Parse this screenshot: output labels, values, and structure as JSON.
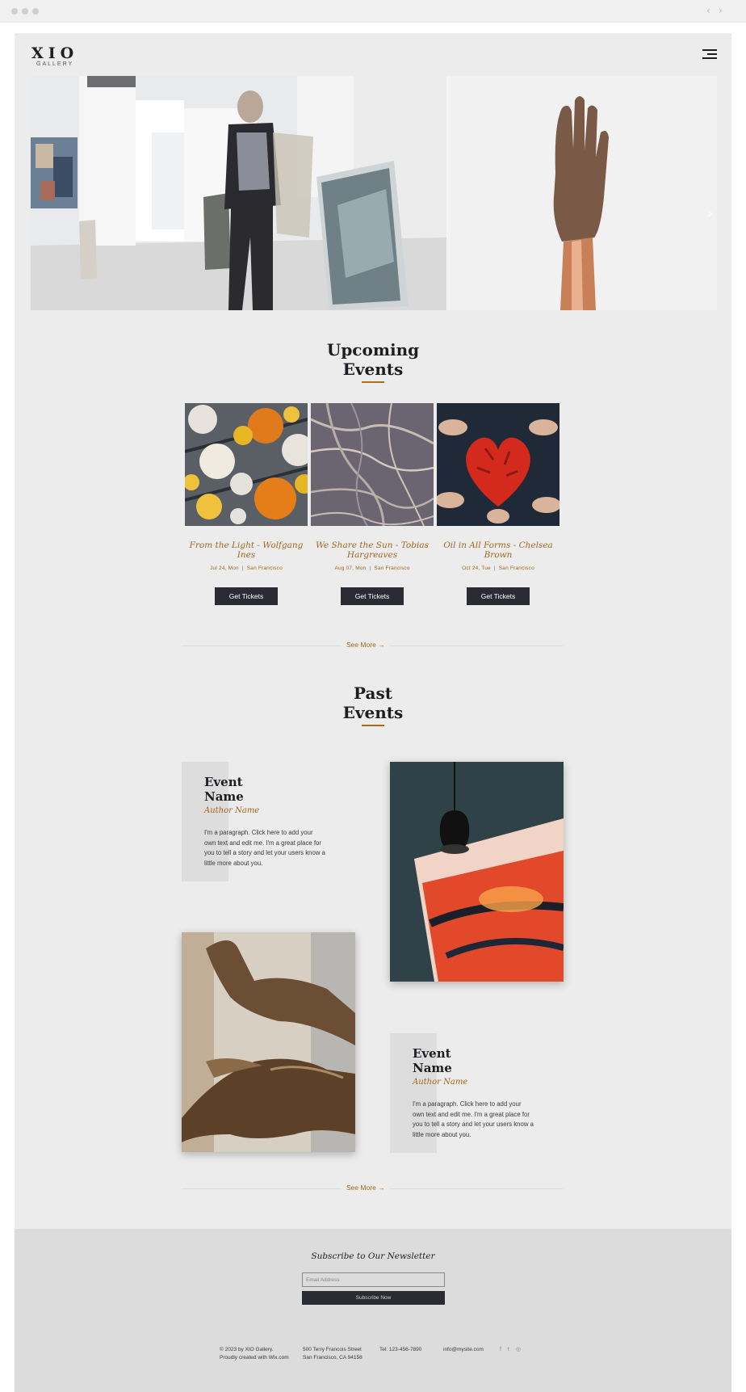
{
  "brand": {
    "name": "XIO",
    "sub": "GALLERY"
  },
  "colors": {
    "accent": "#a5661c",
    "dark": "#2b2c33",
    "page_bg": "#ececec",
    "footer_bg": "#dcdcdc"
  },
  "upcoming": {
    "title_line1": "Upcoming",
    "title_line2": "Events",
    "events": [
      {
        "title": "From the Light - Wolfgang Ines",
        "date": "Jul 24, Mon",
        "location": "San Francisco",
        "button": "Get Tickets"
      },
      {
        "title": "We Share the Sun - Tobias Hargreaves",
        "date": "Aug 07, Mon",
        "location": "San Francisco",
        "button": "Get Tickets"
      },
      {
        "title": "Oil in All Forms - Chelsea Brown",
        "date": "Oct 24, Tue",
        "location": "San Francisco",
        "button": "Get Tickets"
      }
    ],
    "see_more": "See More"
  },
  "past": {
    "title_line1": "Past",
    "title_line2": "Events",
    "items": [
      {
        "name_line1": "Event",
        "name_line2": "Name",
        "author": "Author Name",
        "paragraph": "I'm a paragraph. Click here to add your own text and edit me. I'm a great place for you to tell a story and let your users know a little more about you."
      },
      {
        "name_line1": "Event",
        "name_line2": "Name",
        "author": "Author Name",
        "paragraph": "I'm a paragraph. Click here to add your own text and edit me. I'm a great place for you to tell a story and let your users know a little more about you."
      }
    ],
    "see_more": "See More"
  },
  "footer": {
    "newsletter_title": "Subscribe to Our Newsletter",
    "email_placeholder": "Email Address",
    "subscribe_button": "Subscribe Now",
    "copyright_line1": "© 2023 by XIO Gallery.",
    "copyright_line2": "Proudly created with Wix.com",
    "address_line1": "500 Terry Francois Street",
    "address_line2": "San Francisco, CA 94158",
    "phone": "Tel: 123-456-7890",
    "email": "info@mysite.com",
    "social_icons": [
      "facebook-icon",
      "twitter-icon",
      "instagram-icon"
    ]
  }
}
